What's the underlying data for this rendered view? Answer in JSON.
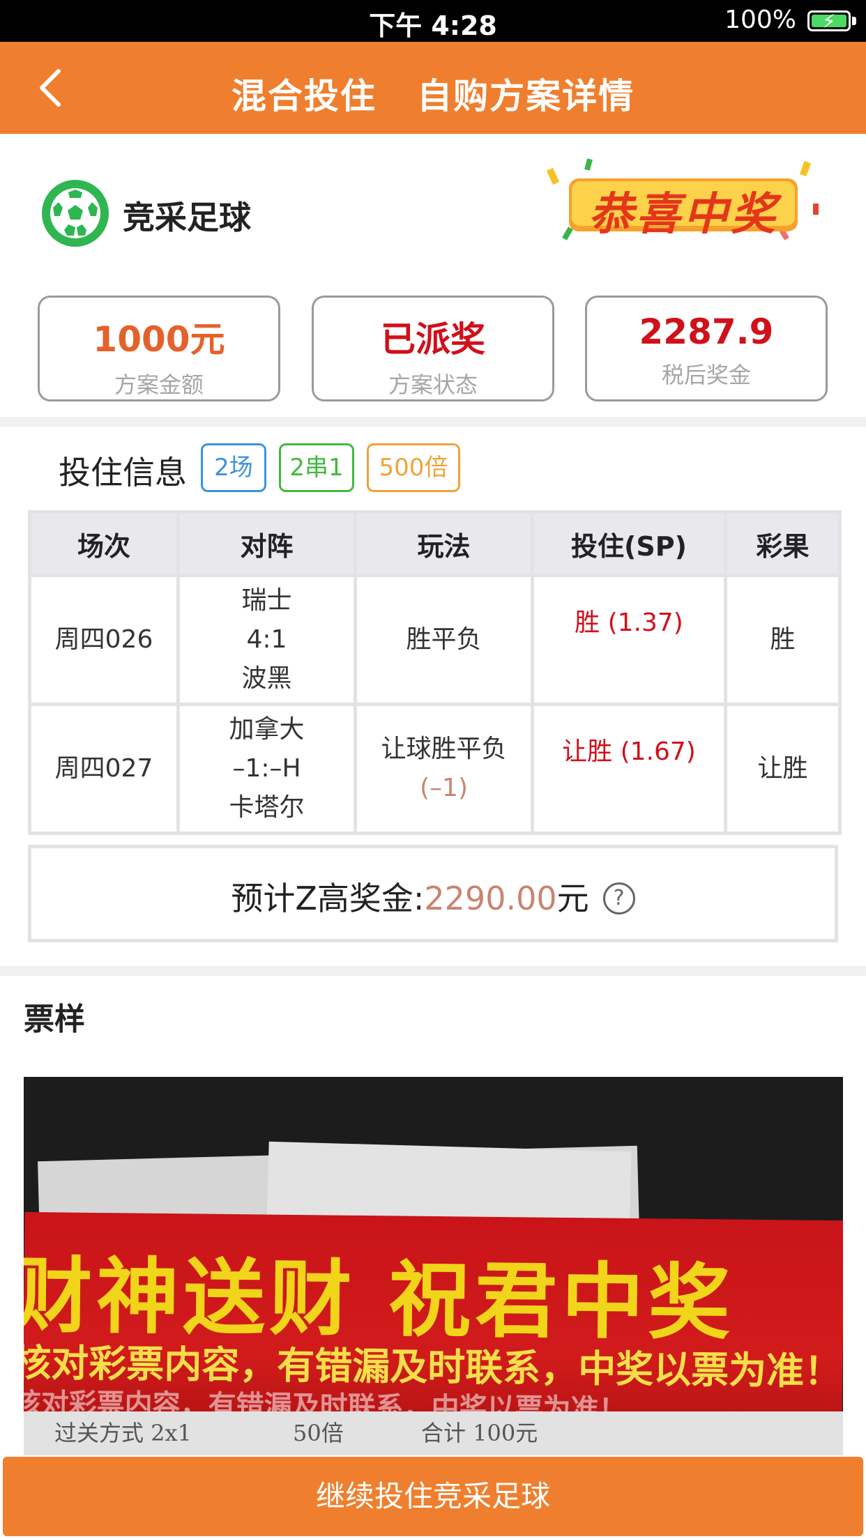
{
  "status_bar": {
    "time": "下午 4:28",
    "battery": "100%"
  },
  "nav": {
    "title": "混合投住   自购方案详情"
  },
  "lottery": {
    "name": "竞采足球",
    "badge_text": "恭喜中奖"
  },
  "stats": [
    {
      "value": "1000元",
      "label": "方案金额"
    },
    {
      "value": "已派奖",
      "label": "方案状态"
    },
    {
      "value": "2287.9",
      "label": "税后奖金"
    }
  ],
  "bet_info": {
    "title": "投住信息",
    "tags": [
      "2场",
      "2串1",
      "500倍"
    ],
    "headers": [
      "场次",
      "对阵",
      "玩法",
      "投住(SP)",
      "彩果"
    ],
    "rows": [
      {
        "match_no": "周四026",
        "home": "瑞士",
        "score": "4:1",
        "away": "波黑",
        "play": "胜平负",
        "play_sub": "",
        "pick": "胜 (1.37)",
        "result": "胜"
      },
      {
        "match_no": "周四027",
        "home": "加拿大",
        "score": "–1:–H",
        "away": "卡塔尔",
        "play": "让球胜平负",
        "play_sub": "(–1)",
        "pick": "让胜 (1.67)",
        "result": "让胜"
      }
    ],
    "max_prize_label": "预计Z高奖金:",
    "max_prize_amount": "2290.00",
    "max_prize_unit": "元"
  },
  "ticket": {
    "title": "票样",
    "banner_big": "财神送财  祝君中奖",
    "banner_small": "核对彩票内容，有错漏及时联系，中奖以票为准！",
    "banner_small2": "核对彩票内容，有错漏及时联系，中奖以票为准！",
    "row_pass": "过关方式 2x1",
    "row_mult": "50倍",
    "row_total": "合计 100元"
  },
  "bottom_button": "继续投住竞采足球",
  "colors": {
    "accent": "#ef7f2e",
    "red": "#d0101b",
    "green": "#2fb650"
  }
}
